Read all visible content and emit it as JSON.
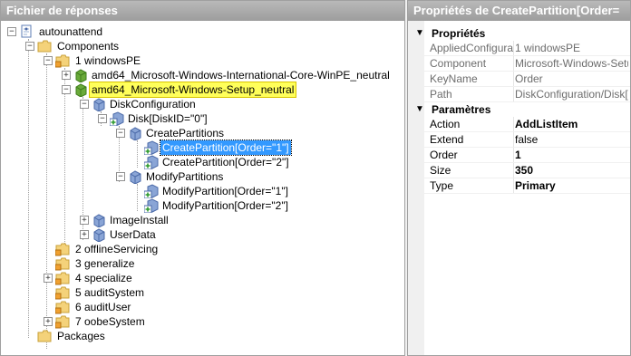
{
  "left_title": "Fichier de réponses",
  "right_title": "Propriétés de CreatePartition[Order=",
  "tree": {
    "root": "autounattend",
    "components": "Components",
    "pass1": "1 windowsPE",
    "intl": "amd64_Microsoft-Windows-International-Core-WinPE_neutral",
    "setup": "amd64_Microsoft-Windows-Setup_neutral",
    "diskconfig": "DiskConfiguration",
    "disk": "Disk[DiskID=\"0\"]",
    "createparts": "CreatePartitions",
    "cp1": "CreatePartition[Order=\"1\"]",
    "cp2": "CreatePartition[Order=\"2\"]",
    "modparts": "ModifyPartitions",
    "mp1": "ModifyPartition[Order=\"1\"]",
    "mp2": "ModifyPartition[Order=\"2\"]",
    "imageinstall": "ImageInstall",
    "userdata": "UserData",
    "pass2": "2 offlineServicing",
    "pass3": "3 generalize",
    "pass4": "4 specialize",
    "pass5": "5 auditSystem",
    "pass6": "6 auditUser",
    "pass7": "7 oobeSystem",
    "packages": "Packages"
  },
  "props": {
    "cat1": "Propriétés",
    "cat1_rows": [
      {
        "name": "AppliedConfigurati",
        "value": "1 windowsPE"
      },
      {
        "name": "Component",
        "value": "Microsoft-Windows-Setup"
      },
      {
        "name": "KeyName",
        "value": "Order"
      },
      {
        "name": "Path",
        "value": "DiskConfiguration/Disk[Dis"
      }
    ],
    "cat2": "Paramètres",
    "cat2_rows": [
      {
        "name": "Action",
        "value": "AddListItem"
      },
      {
        "name": "Extend",
        "value": "false"
      },
      {
        "name": "Order",
        "value": "1"
      },
      {
        "name": "Size",
        "value": "350"
      },
      {
        "name": "Type",
        "value": "Primary"
      }
    ]
  },
  "icons": {
    "collapse": "−",
    "expand": "+",
    "chevron": "⌄"
  }
}
